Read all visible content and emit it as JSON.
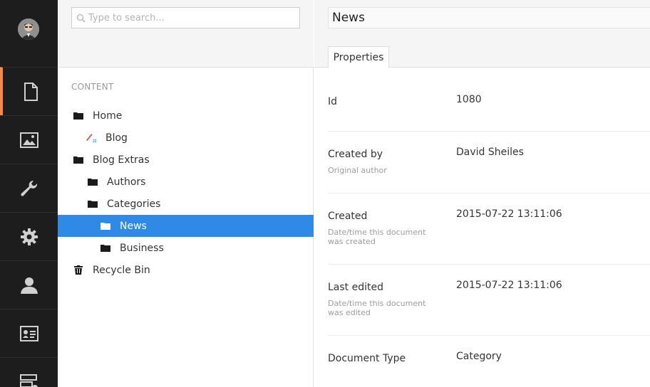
{
  "sidebar": {
    "items": [
      {
        "icon": "document-icon",
        "name": "section-content",
        "active": true
      },
      {
        "icon": "image-icon",
        "name": "section-media"
      },
      {
        "icon": "wrench-icon",
        "name": "section-settings"
      },
      {
        "icon": "gear-icon",
        "name": "section-developer"
      },
      {
        "icon": "user-icon",
        "name": "section-users"
      },
      {
        "icon": "id-card-icon",
        "name": "section-members"
      },
      {
        "icon": "form-icon",
        "name": "section-forms"
      }
    ],
    "accent_color": "#f48a45"
  },
  "tree": {
    "search_placeholder": "Type to search...",
    "section_label": "CONTENT",
    "nodes": [
      {
        "label": "Home",
        "icon": "folder-icon",
        "level": 0
      },
      {
        "label": "Blog",
        "icon": "pencil-icon",
        "level": 1
      },
      {
        "label": "Blog Extras",
        "icon": "folder-icon",
        "level": 0
      },
      {
        "label": "Authors",
        "icon": "folder-icon",
        "level": 1
      },
      {
        "label": "Categories",
        "icon": "folder-icon",
        "level": 1
      },
      {
        "label": "News",
        "icon": "folder-icon",
        "level": 2,
        "selected": true
      },
      {
        "label": "Business",
        "icon": "folder-icon",
        "level": 2
      },
      {
        "label": "Recycle Bin",
        "icon": "trash-icon",
        "level": 0
      }
    ],
    "selected_color": "#2e8ae6"
  },
  "editor": {
    "name_value": "News",
    "tabs": [
      {
        "label": "Properties"
      }
    ],
    "properties": [
      {
        "label": "Id",
        "description": "",
        "value": "1080"
      },
      {
        "label": "Created by",
        "description": "Original author",
        "value": "David Sheiles"
      },
      {
        "label": "Created",
        "description": "Date/time this document was created",
        "value": "2015-07-22 13:11:06"
      },
      {
        "label": "Last edited",
        "description": "Date/time this document was edited",
        "value": "2015-07-22 13:11:06"
      },
      {
        "label": "Document Type",
        "description": "",
        "value": "Category"
      }
    ]
  }
}
